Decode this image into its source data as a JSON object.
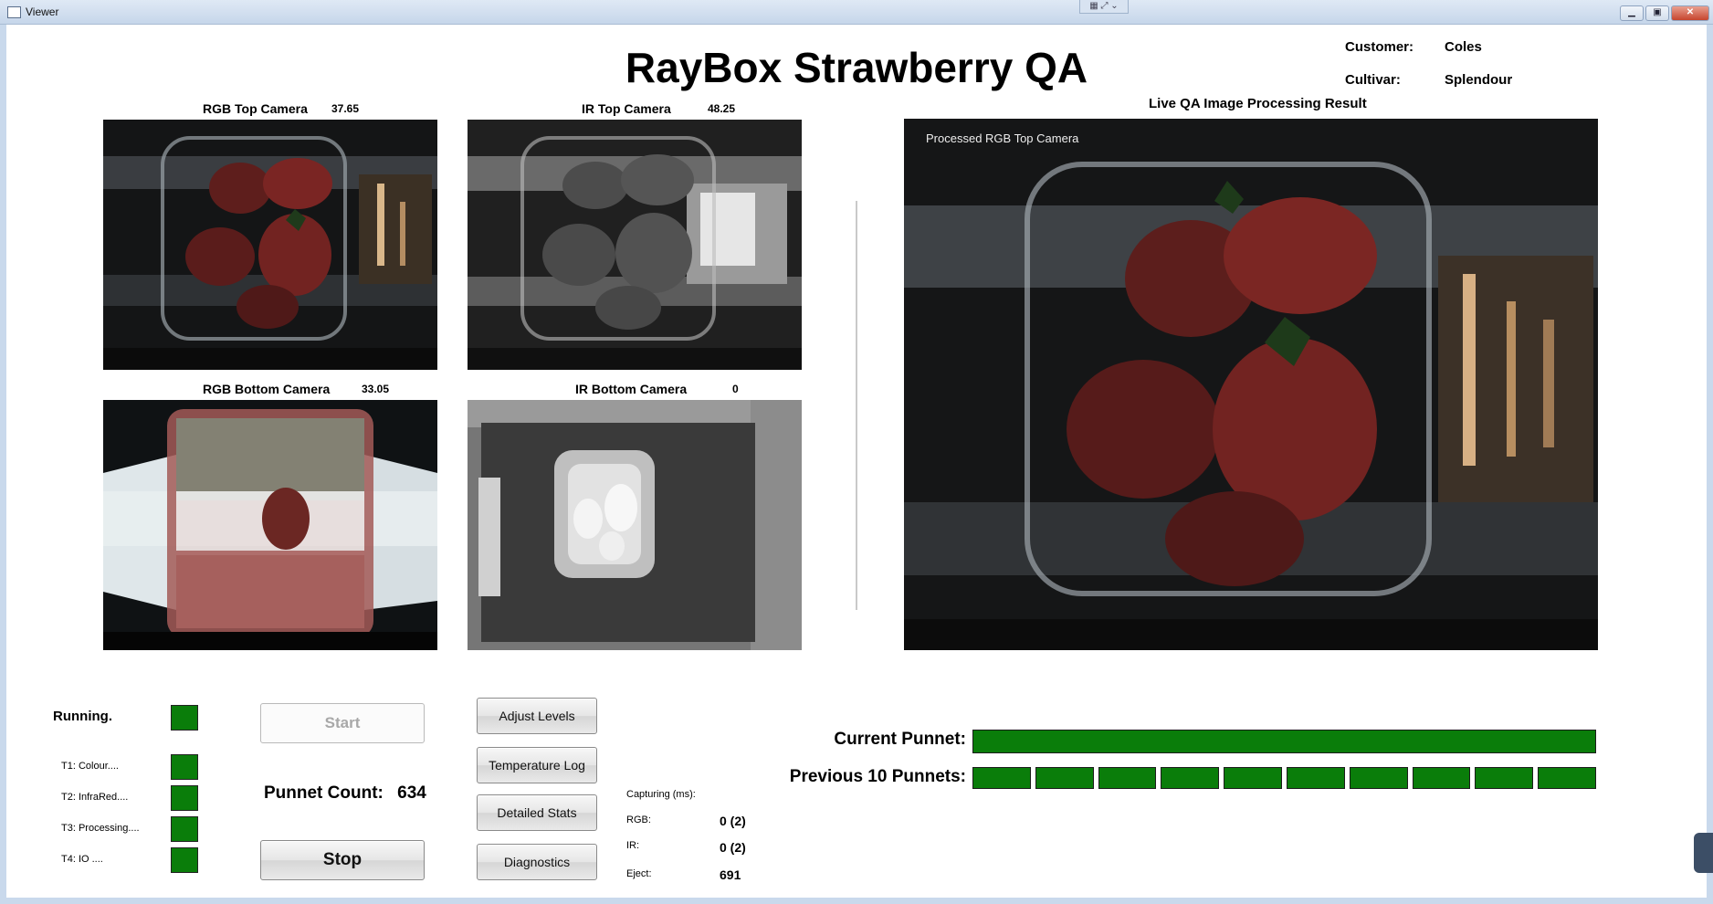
{
  "window": {
    "title": "Viewer"
  },
  "header": {
    "title": "RayBox Strawberry QA",
    "customer_label": "Customer:",
    "customer_value": "Coles",
    "cultivar_label": "Cultivar:",
    "cultivar_value": "Splendour"
  },
  "cameras": [
    {
      "label": "RGB Top Camera",
      "value": "37.65"
    },
    {
      "label": "IR Top Camera",
      "value": "48.25"
    },
    {
      "label": "RGB Bottom Camera",
      "value": "33.05"
    },
    {
      "label": "IR Bottom Camera",
      "value": "0"
    }
  ],
  "live": {
    "title": "Live QA Image Processing Result",
    "caption": "Processed RGB Top Camera"
  },
  "status": {
    "running_label": "Running.",
    "running_color": "#0a7d0a",
    "threads": [
      {
        "label": "T1:   Colour....",
        "color": "#0a7d0a"
      },
      {
        "label": "T2:   InfraRed....",
        "color": "#0a7d0a"
      },
      {
        "label": "T3:   Processing....",
        "color": "#0a7d0a"
      },
      {
        "label": "T4:  IO ....",
        "color": "#0a7d0a"
      }
    ]
  },
  "controls": {
    "start_label": "Start",
    "stop_label": "Stop",
    "punnet_count_label": "Punnet Count:",
    "punnet_count_value": "634",
    "adjust_levels_label": "Adjust Levels",
    "temperature_log_label": "Temperature Log",
    "detailed_stats_label": "Detailed Stats",
    "diagnostics_label": "Diagnostics"
  },
  "capture": {
    "title": "Capturing (ms):",
    "rgb_label": "RGB:",
    "rgb_value": "0 (2)",
    "ir_label": "IR:",
    "ir_value": "0 (2)",
    "eject_label": "Eject:",
    "eject_value": "691"
  },
  "punnets": {
    "current_label": "Current Punnet:",
    "current_color": "#0a7d0a",
    "previous_label": "Previous 10 Punnets:",
    "previous_colors": [
      "#0a7d0a",
      "#0a7d0a",
      "#0a7d0a",
      "#0a7d0a",
      "#0a7d0a",
      "#0a7d0a",
      "#0a7d0a",
      "#0a7d0a",
      "#0a7d0a",
      "#0a7d0a"
    ]
  }
}
